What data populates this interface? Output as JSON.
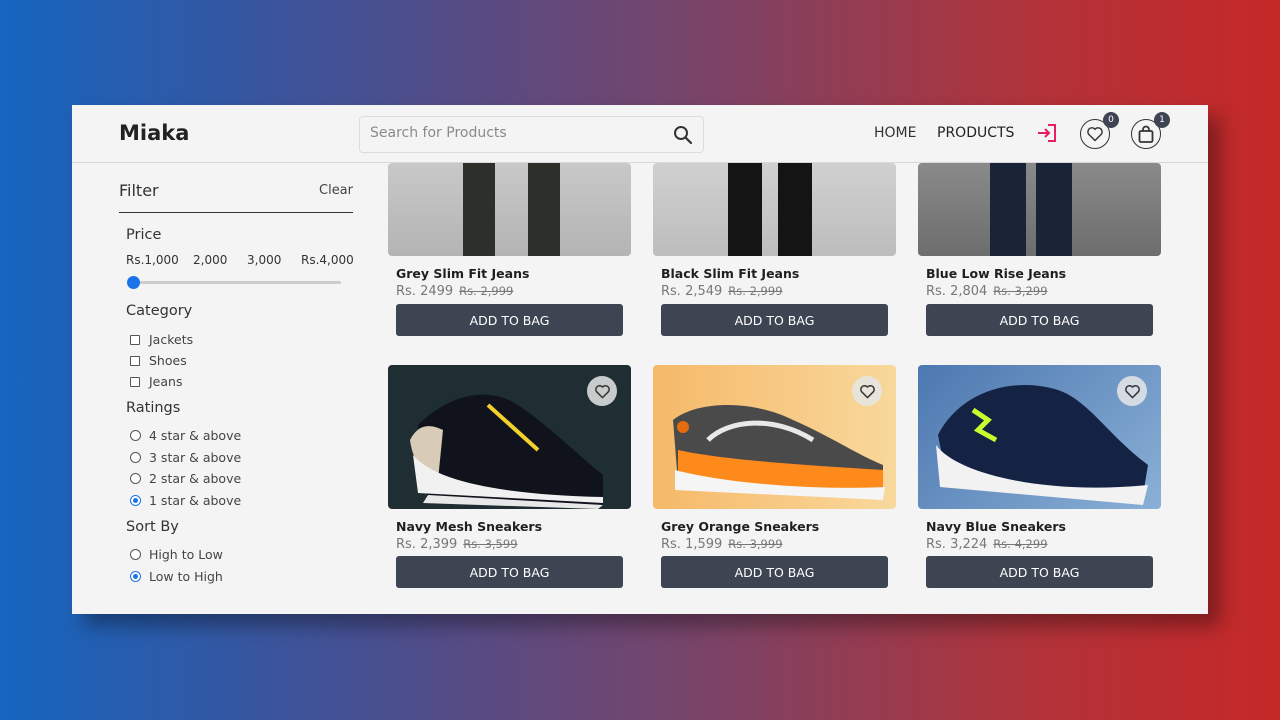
{
  "header": {
    "logo": "Miaka",
    "search_placeholder": "Search for Products",
    "nav_home": "HOME",
    "nav_products": "PRODUCTS",
    "wishlist_count": "0",
    "bag_count": "1",
    "accent_color": "#e91e63"
  },
  "sidebar": {
    "filter_title": "Filter",
    "clear_label": "Clear",
    "price_title": "Price",
    "price_labels": [
      "Rs.1,000",
      "2,000",
      "3,000",
      "Rs.4,000"
    ],
    "price_selected_fraction": 0.0,
    "category_title": "Category",
    "categories": [
      "Jackets",
      "Shoes",
      "Jeans"
    ],
    "ratings_title": "Ratings",
    "ratings": [
      "4 star & above",
      "3 star & above",
      "2 star & above",
      "1 star & above"
    ],
    "ratings_selected": "1 star & above",
    "sort_title": "Sort By",
    "sort_options": [
      "High to Low",
      "Low to High"
    ],
    "sort_selected": "Low to High"
  },
  "products": [
    {
      "name": "Grey Slim Fit Jeans",
      "price": "Rs. 2499",
      "old_price": "Rs. 2,999",
      "button": "ADD TO BAG"
    },
    {
      "name": "Black Slim Fit Jeans",
      "price": "Rs. 2,549",
      "old_price": "Rs. 2,999",
      "button": "ADD TO BAG"
    },
    {
      "name": "Blue Low Rise Jeans",
      "price": "Rs. 2,804",
      "old_price": "Rs. 3,299",
      "button": "ADD TO BAG"
    },
    {
      "name": "Navy Mesh Sneakers",
      "price": "Rs. 2,399",
      "old_price": "Rs. 3,599",
      "button": "ADD TO BAG"
    },
    {
      "name": "Grey Orange Sneakers",
      "price": "Rs. 1,599",
      "old_price": "Rs. 3,999",
      "button": "ADD TO BAG"
    },
    {
      "name": "Navy Blue Sneakers",
      "price": "Rs. 3,224",
      "old_price": "Rs. 4,299",
      "button": "ADD TO BAG"
    }
  ]
}
